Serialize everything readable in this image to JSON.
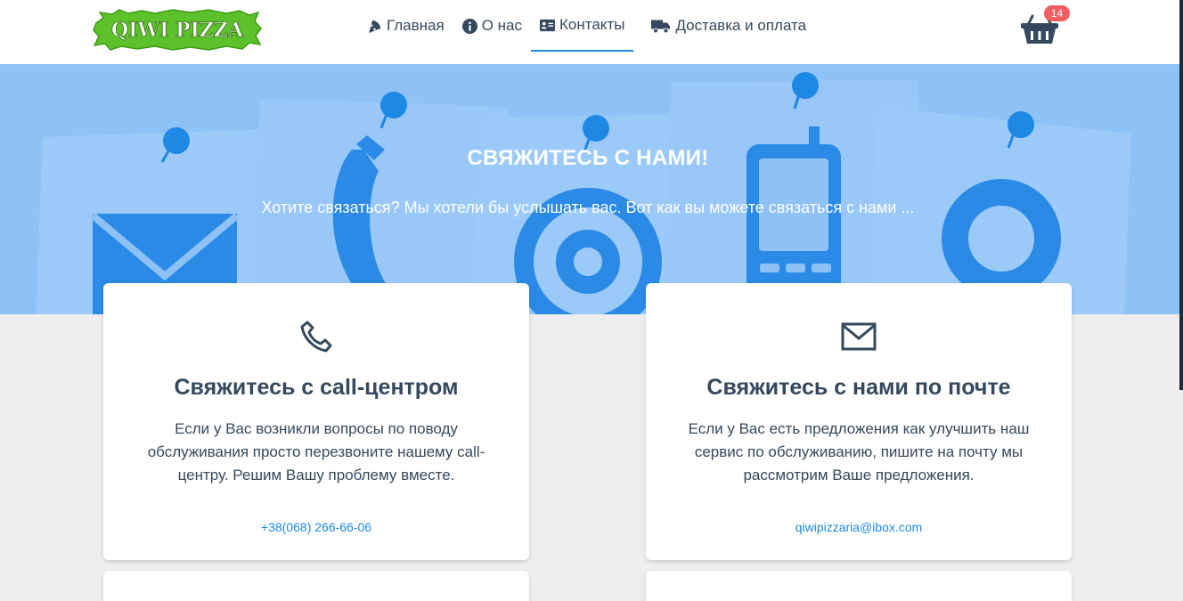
{
  "header": {
    "logo_text": "QIWI PIZZA",
    "nav": [
      {
        "label": "Главная",
        "icon": "pizza-slice-icon"
      },
      {
        "label": "О нас",
        "icon": "info-circle-icon"
      },
      {
        "label": "Контакты",
        "icon": "address-card-icon"
      },
      {
        "label": "Доставка и оплата",
        "icon": "truck-icon"
      }
    ],
    "cart_count": "14"
  },
  "hero": {
    "title": "СВЯЖИТЕСЬ С НАМИ!",
    "subtitle": "Хотите связаться? Мы хотели бы услышать вас. Вот как вы можете связаться с нами ..."
  },
  "cards": [
    {
      "icon": "phone-icon",
      "title": "Свяжитесь с call-центром",
      "text": "Если у Вас возникли вопросы по поводу обслуживания просто перезвоните нашему call-центру. Решим Вашу проблему вместе.",
      "link": "+38(068) 266-66-06"
    },
    {
      "icon": "envelope-icon",
      "title": "Свяжитесь с нами по почте",
      "text": "Если у Вас есть предложения как улучшить наш сервис по обслуживанию, пишите на почту мы рассмотрим Ваше предложения.",
      "link": "qiwipizzaria@ibox.com"
    }
  ],
  "colors": {
    "accent": "#1e88e5",
    "hero_bg": "#8ec2f7",
    "logo_green": "#5cc12a",
    "badge": "#f25d5d",
    "text": "#34495e"
  }
}
